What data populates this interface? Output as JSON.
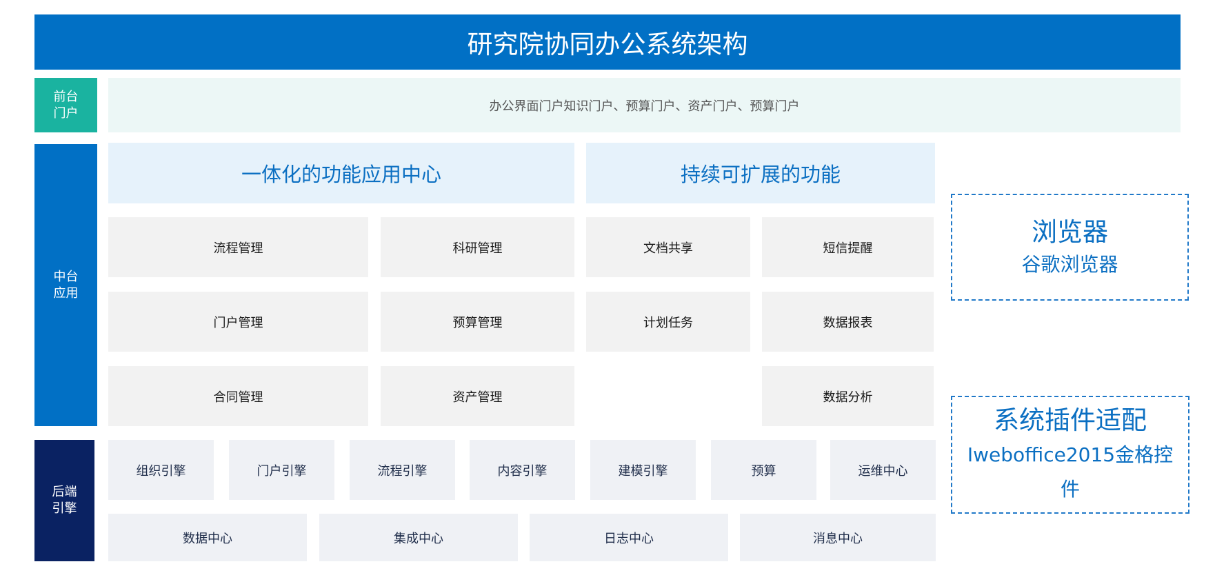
{
  "title": "研究院协同办公系统架构",
  "layers": {
    "frontend": {
      "label_line1": "前台",
      "label_line2": "门户"
    },
    "middle": {
      "label_line1": "中台",
      "label_line2": "应用"
    },
    "backend": {
      "label_line1": "后端",
      "label_line2": "引擎"
    }
  },
  "portal": {
    "text": "办公界面门户知识门户、预算门户、资产门户、预算门户"
  },
  "sections": {
    "integrated": {
      "title": "一体化的功能应用中心",
      "items": [
        "流程管理",
        "科研管理",
        "门户管理",
        "预算管理",
        "合同管理",
        "资产管理"
      ]
    },
    "extensible": {
      "title": "持续可扩展的功能",
      "items": [
        "文档共享",
        "短信提醒",
        "计划任务",
        "数据报表",
        "数据分析"
      ]
    }
  },
  "engines": {
    "row1": [
      "组织引擎",
      "门户引擎",
      "流程引擎",
      "内容引擎",
      "建模引擎",
      "预算",
      "运维中心"
    ],
    "row2": [
      "数据中心",
      "集成中心",
      "日志中心",
      "消息中心"
    ]
  },
  "side_panels": {
    "browser": {
      "title": "浏览器",
      "subtitle": "谷歌浏览器"
    },
    "plugin": {
      "title": "系统插件适配",
      "subtitle": "Iweboffice2015金格控件"
    }
  },
  "colors": {
    "primary_blue": "#0170c5",
    "teal": "#1ab3a0",
    "navy": "#0a2262",
    "portal_bg": "#ecf7f6",
    "header_bg": "#e6f2fb",
    "box_bg": "#f2f2f2"
  }
}
